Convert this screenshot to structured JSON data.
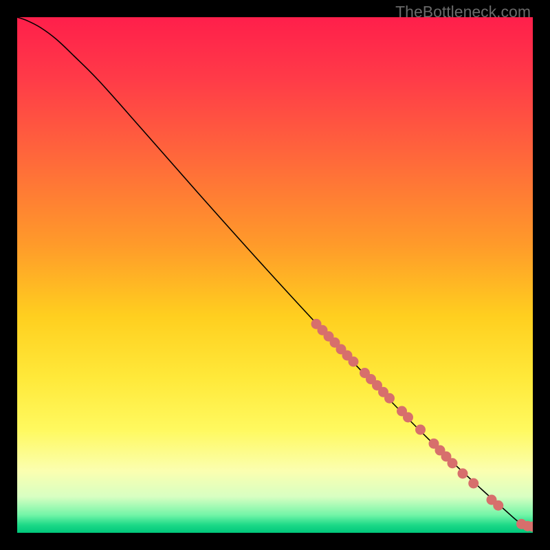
{
  "watermark": "TheBottleneck.com",
  "chart_data": {
    "type": "line",
    "title": "",
    "xlabel": "",
    "ylabel": "",
    "xlim": [
      0,
      100
    ],
    "ylim": [
      0,
      100
    ],
    "grid": false,
    "legend": false,
    "background": {
      "type": "vertical-gradient",
      "stops": [
        {
          "pos": 0.0,
          "color": "#ff1f4b"
        },
        {
          "pos": 0.12,
          "color": "#ff3b48"
        },
        {
          "pos": 0.28,
          "color": "#ff6a3a"
        },
        {
          "pos": 0.44,
          "color": "#ff9a2a"
        },
        {
          "pos": 0.58,
          "color": "#ffcf1f"
        },
        {
          "pos": 0.7,
          "color": "#ffe93a"
        },
        {
          "pos": 0.8,
          "color": "#fff95f"
        },
        {
          "pos": 0.88,
          "color": "#fbffb0"
        },
        {
          "pos": 0.93,
          "color": "#d8ffc2"
        },
        {
          "pos": 0.965,
          "color": "#74f5a8"
        },
        {
          "pos": 0.985,
          "color": "#1cd987"
        },
        {
          "pos": 1.0,
          "color": "#00c77b"
        }
      ]
    },
    "series": [
      {
        "name": "curve",
        "color": "#000000",
        "stroke_width": 1.6,
        "points": [
          {
            "x": 0.0,
            "y": 100.0
          },
          {
            "x": 2.0,
            "y": 99.3
          },
          {
            "x": 4.5,
            "y": 98.0
          },
          {
            "x": 7.5,
            "y": 95.8
          },
          {
            "x": 11.0,
            "y": 92.5
          },
          {
            "x": 16.0,
            "y": 87.5
          },
          {
            "x": 24.0,
            "y": 78.5
          },
          {
            "x": 35.0,
            "y": 66.0
          },
          {
            "x": 48.0,
            "y": 51.5
          },
          {
            "x": 60.0,
            "y": 38.5
          },
          {
            "x": 72.0,
            "y": 26.0
          },
          {
            "x": 82.0,
            "y": 16.0
          },
          {
            "x": 90.0,
            "y": 8.5
          },
          {
            "x": 94.5,
            "y": 4.5
          },
          {
            "x": 97.0,
            "y": 2.3
          },
          {
            "x": 98.5,
            "y": 1.4
          },
          {
            "x": 100.0,
            "y": 1.2
          }
        ]
      }
    ],
    "markers": {
      "name": "highlighted-points",
      "color": "#d76f6c",
      "radius": 7.5,
      "points": [
        {
          "x": 58.0,
          "y": 40.5
        },
        {
          "x": 59.2,
          "y": 39.3
        },
        {
          "x": 60.4,
          "y": 38.1
        },
        {
          "x": 61.6,
          "y": 36.9
        },
        {
          "x": 62.8,
          "y": 35.6
        },
        {
          "x": 64.0,
          "y": 34.4
        },
        {
          "x": 65.2,
          "y": 33.2
        },
        {
          "x": 67.4,
          "y": 31.0
        },
        {
          "x": 68.6,
          "y": 29.8
        },
        {
          "x": 69.8,
          "y": 28.6
        },
        {
          "x": 71.0,
          "y": 27.3
        },
        {
          "x": 72.2,
          "y": 26.1
        },
        {
          "x": 74.6,
          "y": 23.6
        },
        {
          "x": 75.8,
          "y": 22.4
        },
        {
          "x": 78.2,
          "y": 20.0
        },
        {
          "x": 80.8,
          "y": 17.3
        },
        {
          "x": 82.0,
          "y": 16.0
        },
        {
          "x": 83.2,
          "y": 14.8
        },
        {
          "x": 84.4,
          "y": 13.5
        },
        {
          "x": 86.4,
          "y": 11.5
        },
        {
          "x": 88.5,
          "y": 9.6
        },
        {
          "x": 92.0,
          "y": 6.4
        },
        {
          "x": 93.3,
          "y": 5.3
        },
        {
          "x": 97.8,
          "y": 1.7
        },
        {
          "x": 99.0,
          "y": 1.3
        },
        {
          "x": 100.0,
          "y": 1.2
        }
      ]
    }
  }
}
